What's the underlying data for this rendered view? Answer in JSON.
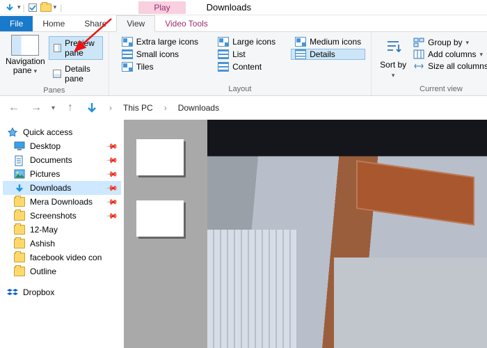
{
  "title": "Downloads",
  "tool_tab": "Play",
  "tool_tab_group": "Video Tools",
  "tabs": {
    "file": "File",
    "home": "Home",
    "share": "Share",
    "view": "View"
  },
  "ribbon": {
    "panes": {
      "label": "Panes",
      "nav": "Navigation pane",
      "preview": "Preview pane",
      "details": "Details pane"
    },
    "layout": {
      "label": "Layout",
      "xl": "Extra large icons",
      "lg": "Large icons",
      "md": "Medium icons",
      "sm": "Small icons",
      "list": "List",
      "details": "Details",
      "tiles": "Tiles",
      "content": "Content"
    },
    "sort": {
      "label": "Current view",
      "sortby": "Sort by",
      "group": "Group by",
      "addcols": "Add columns",
      "sizeall": "Size all columns to f"
    }
  },
  "breadcrumb": [
    "This PC",
    "Downloads"
  ],
  "sidebar": {
    "quick": "Quick access",
    "items": [
      {
        "label": "Desktop",
        "ic": "desktop",
        "pin": true
      },
      {
        "label": "Documents",
        "ic": "docs",
        "pin": true
      },
      {
        "label": "Pictures",
        "ic": "pics",
        "pin": true
      },
      {
        "label": "Downloads",
        "ic": "downloads",
        "pin": true,
        "sel": true
      },
      {
        "label": "Mera Downloads",
        "ic": "folder",
        "pin": true
      },
      {
        "label": "Screenshots",
        "ic": "folder",
        "pin": true
      },
      {
        "label": "12-May",
        "ic": "folder"
      },
      {
        "label": "Ashish",
        "ic": "folder"
      },
      {
        "label": "facebook video con",
        "ic": "folder"
      },
      {
        "label": "Outline",
        "ic": "folder"
      }
    ],
    "dropbox": "Dropbox"
  }
}
